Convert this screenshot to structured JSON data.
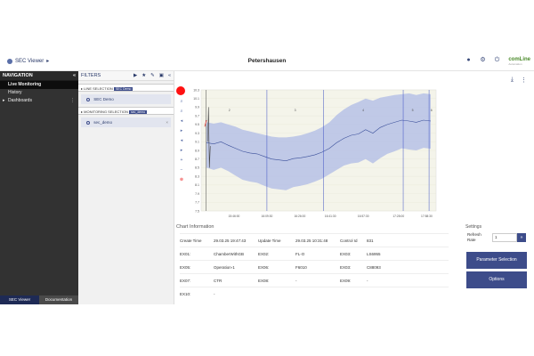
{
  "header": {
    "app_name": "SEC Viewer",
    "app_chevron": "▸",
    "page_title": "Petershausen",
    "icons": [
      "user-icon",
      "gear-icon",
      "power-icon"
    ],
    "brand": "comLine",
    "brand_sub": "Automation"
  },
  "nav": {
    "title": "NAVIGATION",
    "collapse": "«",
    "items": [
      {
        "label": "Live Monitoring",
        "active": true
      },
      {
        "label": "History",
        "active": false
      },
      {
        "label": "Dashboards",
        "active": false,
        "expand": "▸",
        "more": "⋮"
      }
    ],
    "footer": [
      "SEC Viewer",
      "Documentation"
    ]
  },
  "filters": {
    "title": "FILTERS",
    "icons": [
      "▶",
      "★",
      "✎",
      "▣",
      "«"
    ],
    "sections": [
      {
        "label": "LINE SELECTION",
        "tag": "SEC Demo",
        "chip": "SEC Demo"
      },
      {
        "label": "MONITORING SELECTION",
        "tag": "sec_demo",
        "chip": "sec_demo",
        "chip_close": "×"
      }
    ]
  },
  "toolbar": {
    "tools": [
      "⌕",
      "⌕",
      "◂",
      "▸",
      "◂",
      "▸",
      "+",
      "−",
      "⊗"
    ]
  },
  "export_icons": [
    "⤓",
    "⋮"
  ],
  "chart_data": {
    "type": "line",
    "ylim": [
      7.5,
      10.3
    ],
    "y_ticks": [
      "10.3",
      "10.1",
      "9.9",
      "9.7",
      "9.5",
      "9.3",
      "9.1",
      "8.9",
      "8.7",
      "8.5",
      "8.3",
      "8.1",
      "7.9",
      "7.7",
      "7.5"
    ],
    "x_ticks": [
      "15:46:00",
      "16:09:30",
      "16:26:00",
      "16:41:30",
      "16:57:30",
      "17:28:00",
      "17:58:30"
    ],
    "segment_labels": [
      "2",
      "3",
      "4",
      "5",
      "6"
    ],
    "series": [
      {
        "role": "mean",
        "values": [
          9.08,
          9.05,
          9.1,
          9.02,
          8.95,
          8.88,
          8.84,
          8.82,
          8.76,
          8.7,
          8.68,
          8.66,
          8.71,
          8.73,
          8.76,
          8.8,
          8.86,
          8.95,
          9.08,
          9.18,
          9.25,
          9.28,
          9.38,
          9.3,
          9.43,
          9.5,
          9.55,
          9.6,
          9.58,
          9.55,
          9.6,
          9.58
        ],
        "upper": [
          9.55,
          9.52,
          9.55,
          9.5,
          9.45,
          9.38,
          9.34,
          9.3,
          9.26,
          9.22,
          9.2,
          9.2,
          9.22,
          9.25,
          9.3,
          9.36,
          9.44,
          9.55,
          9.72,
          9.85,
          9.95,
          10.02,
          10.1,
          10.05,
          10.12,
          10.15,
          10.18,
          10.2,
          10.22,
          10.18,
          10.22,
          10.2
        ],
        "lower": [
          8.5,
          8.45,
          8.5,
          8.42,
          8.32,
          8.22,
          8.18,
          8.15,
          8.08,
          8.02,
          8.0,
          7.98,
          8.05,
          8.08,
          8.12,
          8.18,
          8.25,
          8.35,
          8.45,
          8.55,
          8.6,
          8.62,
          8.7,
          8.6,
          8.72,
          8.82,
          8.88,
          8.95,
          8.92,
          8.9,
          8.96,
          8.94
        ]
      }
    ],
    "colors": {
      "band": "#b6c1e6",
      "line": "#3a4f9a",
      "bg": "#f4f4ea",
      "boundary": "#3c4fc4",
      "early": "#444444",
      "spike": "#d93333"
    }
  },
  "chart_info": {
    "title": "Chart Information",
    "rows": [
      [
        "Create Time",
        "29.03.25 19:47:43",
        "Update Time",
        "29.03.25 10:31:48",
        "Control Id",
        "831"
      ],
      [
        "EX01:",
        "ChamberWithGB",
        "EX02:",
        "FL-O",
        "EX03:",
        "LS6955"
      ],
      [
        "EX05:",
        "Operation-1",
        "EX06:",
        "F6010",
        "EX03:",
        "C88093"
      ],
      [
        "EX07:",
        "CTR",
        "EX08:",
        "-",
        "EX09:",
        "-"
      ],
      [
        "EX10:",
        "-",
        "",
        "",
        "",
        ""
      ]
    ]
  },
  "settings": {
    "title": "Settings",
    "refresh_label": "Refresh Rate",
    "refresh_value": "1",
    "refresh_button": "»",
    "parameter_button": "Parameter Selection",
    "options_button": "Options"
  }
}
